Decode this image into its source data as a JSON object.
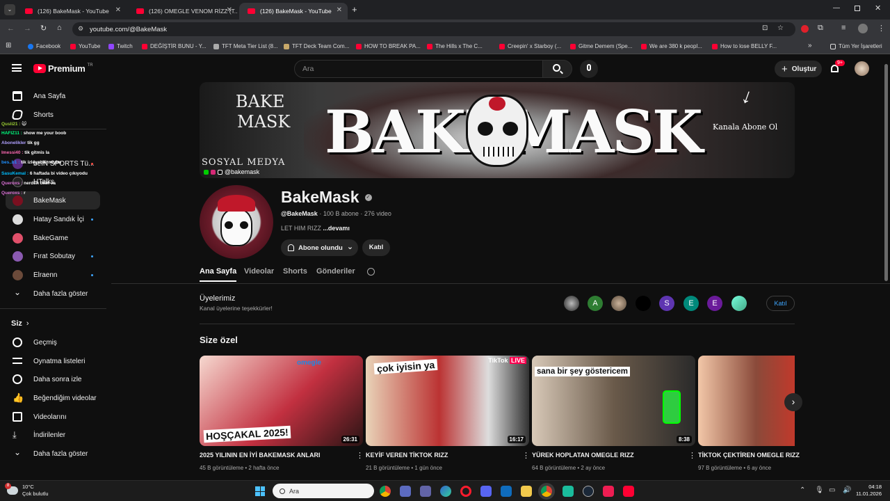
{
  "browser": {
    "tabs": [
      {
        "title": "(126) BakeMask - YouTube"
      },
      {
        "title": "(126) OMEGLE VENOM RİZZ (T..."
      },
      {
        "title": "(126) BakeMask - YouTube"
      }
    ],
    "url": "youtube.com/@BakeMask",
    "bookmarks": [
      "Facebook",
      "YouTube",
      "Twitch",
      "DEĞİŞTİR BUNU - Y...",
      "TFT Meta Tier List (8...",
      "TFT Deck Team Com...",
      "HOW TO BREAK PA...",
      "The Hills x The C...",
      "Creepin' x Starboy (...",
      "Gitme Demem (Spe...",
      "We are 380 k peopl...",
      "How to lose BELLY F..."
    ],
    "all_bookmarks": "Tüm Yer İşaretleri"
  },
  "yt": {
    "logo": "Premium",
    "logo_sup": "TR",
    "search_placeholder": "Ara",
    "create": "Oluştur",
    "notif_badge": "9+"
  },
  "sidebar": {
    "items": [
      {
        "label": "Ana Sayfa"
      },
      {
        "label": "Shorts"
      }
    ],
    "subs": [
      {
        "label": "beIN SPORTS Tü..."
      },
      {
        "label": "HTalks"
      },
      {
        "label": "BakeMask"
      },
      {
        "label": "Hatay Sandık İçi"
      },
      {
        "label": "BakeGame"
      },
      {
        "label": "Fırat Sobutay"
      },
      {
        "label": "Elraenn"
      },
      {
        "label": "Daha fazla göster"
      }
    ],
    "you_header": "Siz",
    "you": [
      {
        "label": "Geçmiş"
      },
      {
        "label": "Oynatma listeleri"
      },
      {
        "label": "Daha sonra izle"
      },
      {
        "label": "Beğendiğim videolar"
      },
      {
        "label": "Videolarını"
      },
      {
        "label": "İndirilenler"
      },
      {
        "label": "Daha fazla göster"
      }
    ]
  },
  "chat": [
    {
      "name": "Qusli21 :",
      "msg": "🙀",
      "color": "#9acd32"
    },
    {
      "name": "HAFIZ11 :",
      "msg": "show me your boob",
      "color": "#00ff7f"
    },
    {
      "name": "Abonelikler",
      "msg": "tik gg",
      "color": "#b0a0ff"
    },
    {
      "name": "Imessi40 :",
      "msg": "tik gitmis la",
      "color": "#ff69b4"
    },
    {
      "name": "bes..b1 :",
      "msg": "tik izleyebilirmiyim",
      "color": "#1e90ff"
    },
    {
      "name": "SasuKemal :",
      "msg": "6 haftada bi video çıkıyodu",
      "color": "#00bfff"
    },
    {
      "name": "Queroxs :",
      "msg": "nerden tikin va",
      "color": "#da70d6"
    },
    {
      "name": "Queroxs :",
      "msg": "r",
      "color": "#da70d6"
    }
  ],
  "banner": {
    "left1": "BAKE",
    "left2": "MASK",
    "center": "BAKEMASK",
    "social": "SOSYAL MEDYA",
    "handle": "@bakemask",
    "cta": "Kanala Abone Ol"
  },
  "channel": {
    "name": "BakeMask",
    "handle": "@BakeMask",
    "subs": "· 100 B abone · 276 video",
    "desc": "LET HIM RIZZ",
    "more": "...devamı",
    "subscribed": "Abone olundu",
    "join": "Katıl"
  },
  "channel_tabs": [
    "Ana Sayfa",
    "Videolar",
    "Shorts",
    "Gönderiler"
  ],
  "members": {
    "title": "Üyelerimiz",
    "subtitle": "Kanal üyelerine teşekkürler!",
    "letters": [
      "A",
      "S",
      "E",
      "E"
    ],
    "join": "Katıl"
  },
  "section": "Size özel",
  "videos": [
    {
      "title": "2025 YILININ EN İYİ BAKEMASK ANLARI",
      "views": "45 B görüntüleme",
      "age": "2 hafta önce",
      "duration": "26:31",
      "overlay": "HOŞÇAKAL 2025!"
    },
    {
      "title": "KEYİF VEREN TİKTOK RIZZ",
      "views": "21 B görüntüleme",
      "age": "1 gün önce",
      "duration": "16:17",
      "overlay": "çok iyisin ya"
    },
    {
      "title": "YÜREK HOPLATAN OMEGLE RIZZ",
      "views": "64 B görüntüleme",
      "age": "2 ay önce",
      "duration": "8:38",
      "overlay": "sana bir şey göstericem"
    },
    {
      "title": "TİKTOK ÇEKTİREN OMEGLE RIZZ",
      "views": "97 B görüntüleme",
      "age": "6 ay önce",
      "duration": "",
      "overlay": ""
    }
  ],
  "taskbar": {
    "temp": "10°C",
    "weather": "Çok bulutlu",
    "search": "Ara",
    "time": "04:18",
    "date": "11.01.2026",
    "weather_badge": "8"
  },
  "colors": {
    "accent": "#ff0033",
    "bg": "#0f0f0f"
  }
}
